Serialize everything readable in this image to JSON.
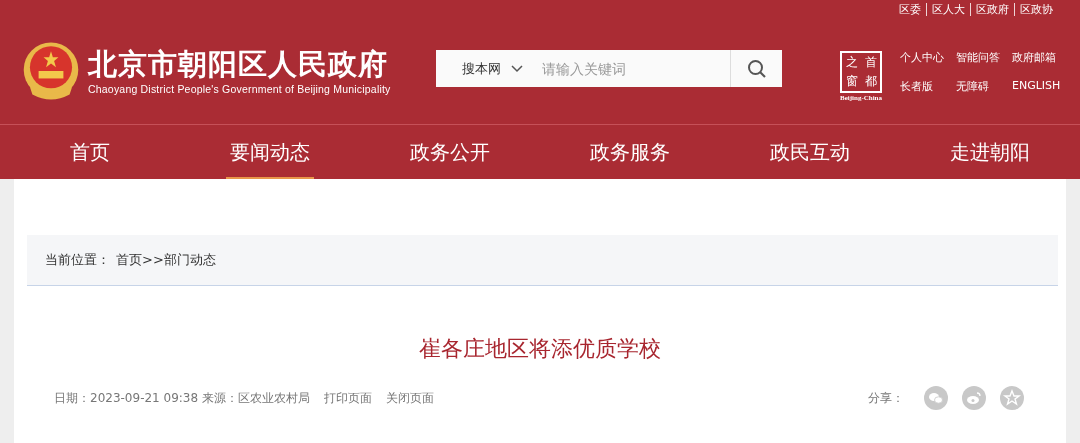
{
  "top_links": [
    "区委",
    "区人大",
    "区政府",
    "区政协"
  ],
  "site": {
    "title": "北京市朝阳区人民政府",
    "subtitle": "Chaoyang District People's Government of Beijing Municipality"
  },
  "search": {
    "scope": "搜本网",
    "placeholder": "请输入关键词"
  },
  "capital_logo": {
    "chars": [
      "之",
      "首",
      "窗",
      "都"
    ],
    "caption": "Beijing-China"
  },
  "quick_links": [
    "个人中心",
    "智能问答",
    "政府邮箱",
    "长者版",
    "无障碍",
    "ENGLISH"
  ],
  "nav": [
    {
      "label": "首页",
      "selected": false
    },
    {
      "label": "要闻动态",
      "selected": true
    },
    {
      "label": "政务公开",
      "selected": false
    },
    {
      "label": "政务服务",
      "selected": false
    },
    {
      "label": "政民互动",
      "selected": false
    },
    {
      "label": "走进朝阳",
      "selected": false
    }
  ],
  "breadcrumb": {
    "label": "当前位置：",
    "path": "首页>>部门动态"
  },
  "article": {
    "title": "崔各庄地区将添优质学校",
    "meta": "日期：2023-09-21 09:38 来源：区农业农村局",
    "actions": [
      "打印页面",
      "关闭页面"
    ],
    "share_label": "分享："
  }
}
